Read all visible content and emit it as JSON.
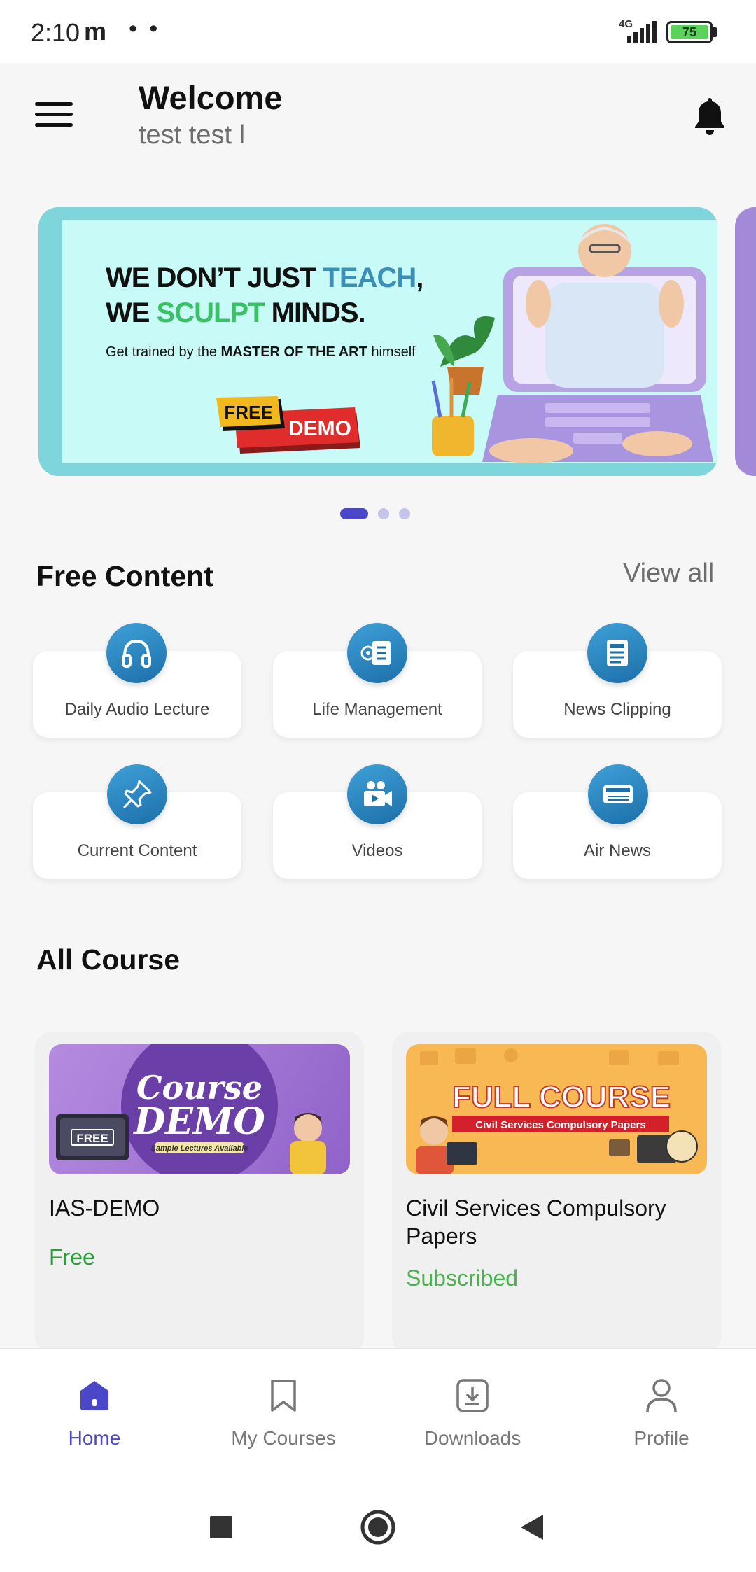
{
  "status_bar": {
    "time": "2:10",
    "notification_dots": "• •",
    "network_label": "4G",
    "battery_level": "75"
  },
  "header": {
    "title": "Welcome",
    "user_name": "test test l"
  },
  "banner": {
    "headline_line1_pre": "WE DON’T JUST ",
    "headline_line1_accent": "TEACH",
    "headline_line1_post": ",",
    "headline_line2_pre": "WE ",
    "headline_line2_accent": "SCULPT",
    "headline_line2_post": " MINDS.",
    "subtitle_pre": "Get trained by the ",
    "subtitle_bold": "MASTER OF THE ART",
    "subtitle_post": " himself",
    "badge_free": "FREE",
    "badge_demo": "DEMO",
    "slide_count": 3,
    "active_slide": 1
  },
  "free_content": {
    "title": "Free Content",
    "view_all": "View all",
    "items": [
      {
        "label": "Daily Audio Lecture",
        "icon": "headphones-icon"
      },
      {
        "label": "Life Management",
        "icon": "settings-document-icon"
      },
      {
        "label": "News Clipping",
        "icon": "newspaper-icon"
      },
      {
        "label": "Current Content",
        "icon": "pin-icon"
      },
      {
        "label": "Videos",
        "icon": "video-camera-icon"
      },
      {
        "label": "Air News",
        "icon": "radio-icon"
      }
    ]
  },
  "all_course": {
    "title": "All Course",
    "courses": [
      {
        "title": "IAS-DEMO",
        "price": "Free",
        "thumb_line1": "Course",
        "thumb_line2": "DEMO",
        "thumb_caption": "Sample Lectures Available",
        "thumb_badge": "FREE"
      },
      {
        "title": "Civil Services Compulsory Papers",
        "price": "Subscribed",
        "thumb_line1": "FULL COURSE",
        "thumb_caption": "Civil Services Compulsory Papers"
      }
    ]
  },
  "bottom_nav": {
    "items": [
      {
        "label": "Home",
        "icon": "home-icon",
        "active": true
      },
      {
        "label": "My Courses",
        "icon": "bookmark-icon",
        "active": false
      },
      {
        "label": "Downloads",
        "icon": "download-icon",
        "active": false
      },
      {
        "label": "Profile",
        "icon": "person-icon",
        "active": false
      }
    ]
  },
  "colors": {
    "accent": "#4b47c9",
    "price_green": "#2e9c3c",
    "banner_teal": "#7fd6da",
    "icon_blue": "#1d6fa8"
  }
}
